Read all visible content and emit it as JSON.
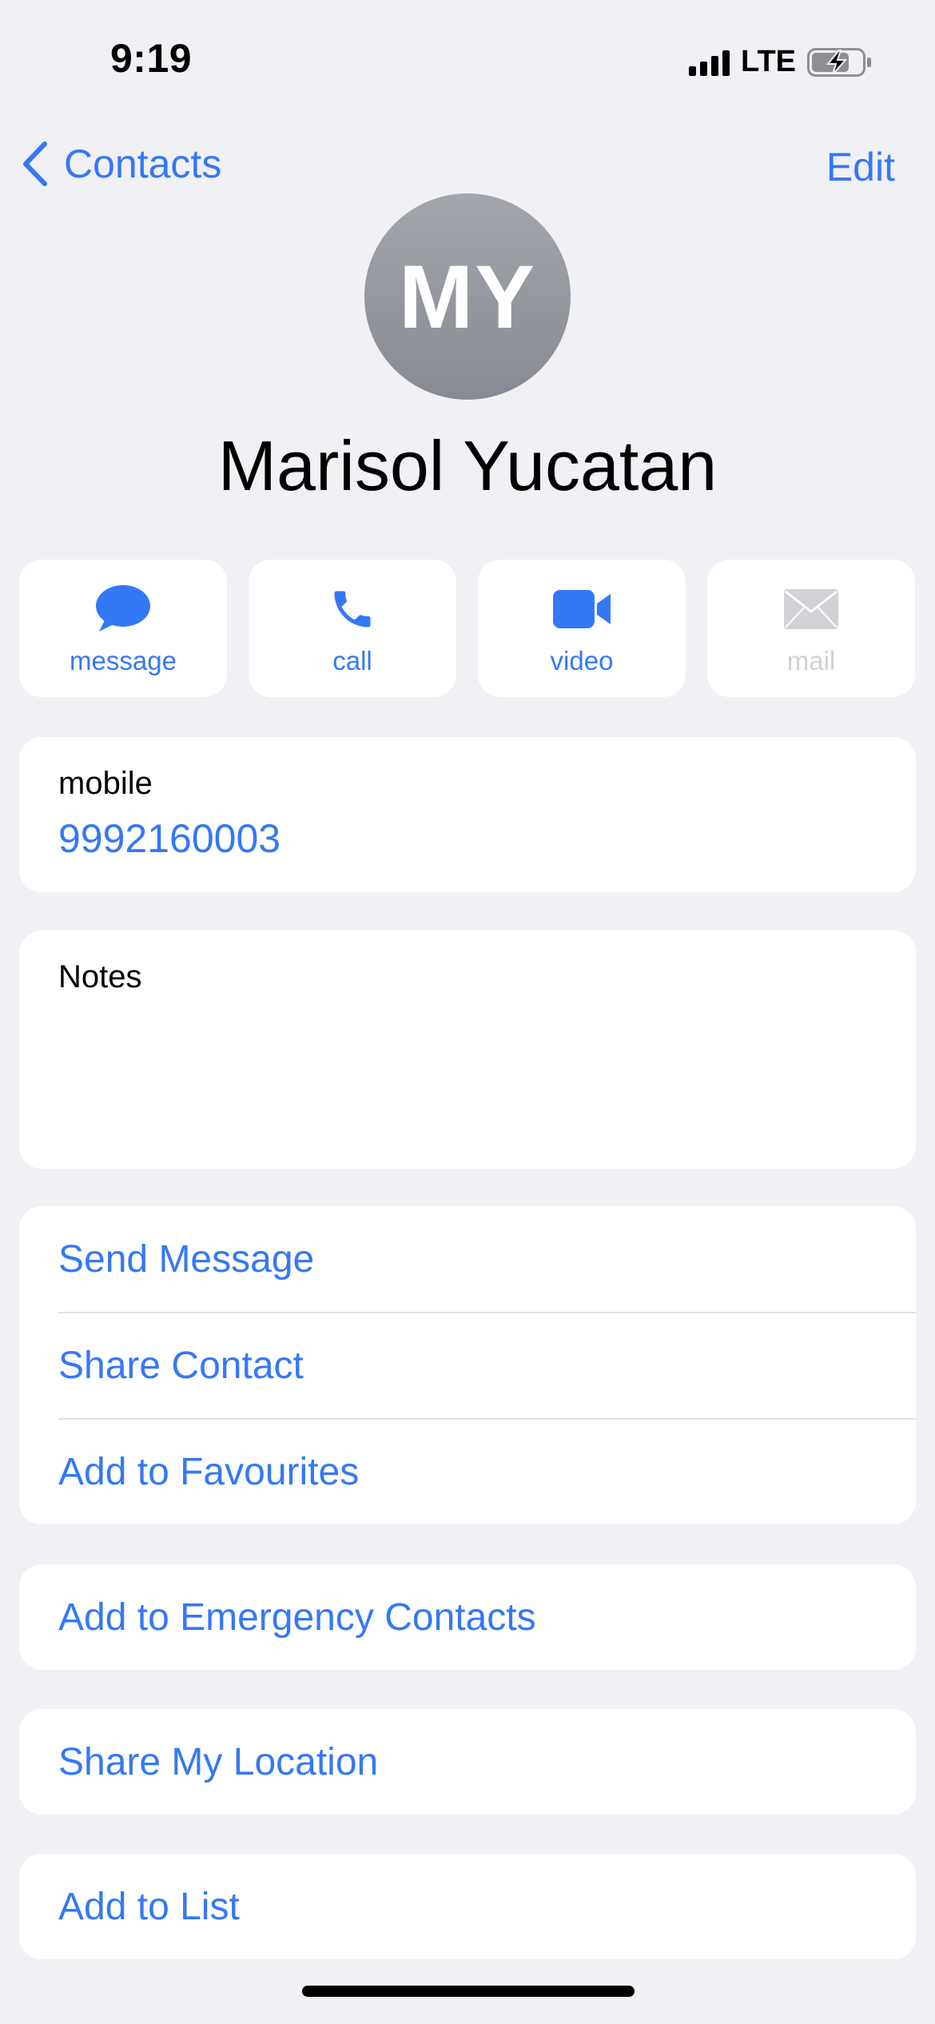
{
  "status_bar": {
    "time": "9:19",
    "network": "LTE"
  },
  "nav": {
    "back_label": "Contacts",
    "edit_label": "Edit"
  },
  "contact": {
    "initials": "MY",
    "name": "Marisol Yucatan"
  },
  "actions": [
    {
      "label": "message",
      "icon": "message-bubble-icon",
      "enabled": true
    },
    {
      "label": "call",
      "icon": "phone-icon",
      "enabled": true
    },
    {
      "label": "video",
      "icon": "video-camera-icon",
      "enabled": true
    },
    {
      "label": "mail",
      "icon": "envelope-icon",
      "enabled": false
    }
  ],
  "phone": {
    "label": "mobile",
    "number": "9992160003"
  },
  "notes": {
    "label": "Notes"
  },
  "options_group": [
    "Send Message",
    "Share Contact",
    "Add to Favourites"
  ],
  "emergency": "Add to Emergency Contacts",
  "location": "Share My Location",
  "list": "Add to List",
  "colors": {
    "accent": "#3478f6",
    "background": "#f0f0f5",
    "card": "#ffffff",
    "disabled": "#d1d1d6"
  }
}
